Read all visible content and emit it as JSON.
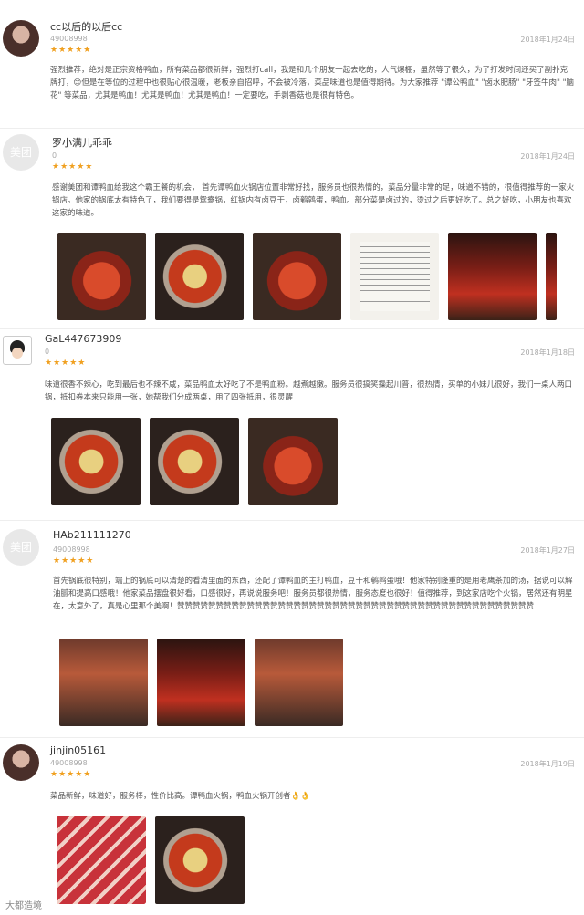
{
  "reviews": [
    {
      "name": "cc以后的以后cc",
      "uid": "49008998",
      "stars": "★★★★★",
      "date": "2018年1月24日",
      "text": "强烈推荐，绝对是正宗资格鸭血，所有菜品都很新鲜，强烈打call，我是和几个朋友一起去吃的，人气爆棚，虽然等了很久，为了打发时间还买了副扑克牌打，😊但是在等位的过程中也很贴心很温暖，老板亲自招呼，不会被冷落，菜品味道也是值得期待。为大家推荐 \"谭公鸭血\" \"卤水肥肠\" \"牙签牛肉\" \"脑花\" 等菜品，尤其是鸭血！尤其是鸭血！尤其是鸭血！一定要吃，手剥香菇也是很有特色。"
    },
    {
      "avatar": "美团",
      "name": "罗小满儿乖乖",
      "uid": "0",
      "stars": "★★★★★",
      "date": "2018年1月24日",
      "text": "感谢美团和谭鸭血给我这个霸王餐的机会， 首先谭鸭血火锅店位置非常好找，服务员也很热情的，菜品分量非常的足，味道不错的，很值得推荐的一家火锅店。他家的锅底太有特色了，我们要得是鸳鸯锅，红锅内有卤豆干，卤鹌鹑蛋，鸭血。部分菜是卤过的，烫过之后更好吃了。总之好吃，小朋友也喜欢这家的味道。"
    },
    {
      "name": "GaL447673909",
      "uid": "0",
      "stars": "★★★★★",
      "date": "2018年1月18日",
      "text": "味道很香不辣心，吃到最后也不辣不咸，菜品鸭血太好吃了不是鸭血粉。越煮越嫩。服务员很搞笑操起川普，很热情，买单的小妹儿很好，我们一桌人两口锅，抵扣券本来只能用一张，她帮我们分成两桌，用了四张抵用，很灵醒"
    },
    {
      "avatar": "美团",
      "name": "HAb211111270",
      "uid": "49008998",
      "stars": "★★★★★",
      "date": "2018年1月27日",
      "text": "首先锅底很特别，端上的锅底可以清楚的看清里面的东西，还配了谭鸭血的主打鸭血，豆干和鹌鹑蛋哦！他家特别隆重的是用老鹰茶加的汤，据说可以解油腻和提高口感哦！他家菜品摆盘很好看，口感很好，再说说服务吧！服务员都很热情，服务态度也很好！值得推荐，到这家店吃个火锅，居然还有明星在，太意外了，真是心里那个美啊！赞赞赞赞赞赞赞赞赞赞赞赞赞赞赞赞赞赞赞赞赞赞赞赞赞赞赞赞赞赞赞赞赞赞赞赞赞赞赞赞赞赞赞赞赞赞"
    },
    {
      "name": "jinjin05161",
      "uid": "49008998",
      "stars": "★★★★★",
      "date": "2018年1月19日",
      "text": "菜品新鲜，味道好，服务棒，性价比高。谭鸭血火锅，鸭血火锅开创者👌👌"
    }
  ],
  "watermark": "大都造境"
}
